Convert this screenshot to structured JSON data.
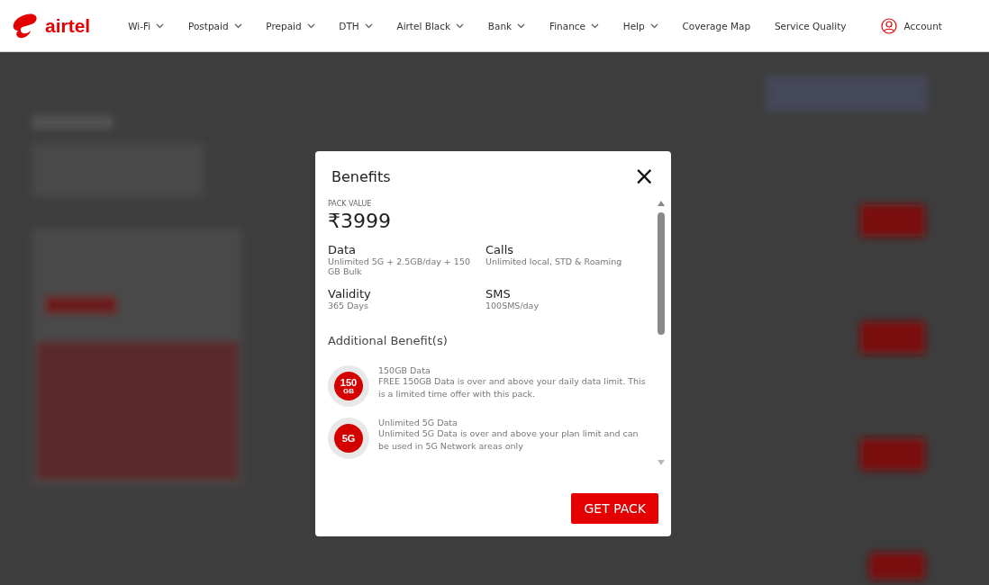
{
  "header": {
    "brand": "airtel",
    "nav": [
      {
        "label": "Wi-Fi",
        "dropdown": true
      },
      {
        "label": "Postpaid",
        "dropdown": true
      },
      {
        "label": "Prepaid",
        "dropdown": true
      },
      {
        "label": "DTH",
        "dropdown": true
      },
      {
        "label": "Airtel Black",
        "dropdown": true
      },
      {
        "label": "Bank",
        "dropdown": true
      },
      {
        "label": "Finance",
        "dropdown": true
      },
      {
        "label": "Help",
        "dropdown": true
      },
      {
        "label": "Coverage Map",
        "dropdown": false
      },
      {
        "label": "Service Quality",
        "dropdown": false
      }
    ],
    "account": "Account"
  },
  "modal": {
    "title": "Benefits",
    "close": "×",
    "pack_value_label": "PACK VALUE",
    "price": "₹3999",
    "details": [
      {
        "label": "Data",
        "value": "Unlimited 5G + 2.5GB/day + 150 GB Bulk"
      },
      {
        "label": "Calls",
        "value": "Unlimited local, STD & Roaming"
      },
      {
        "label": "Validity",
        "value": "365 Days"
      },
      {
        "label": "SMS",
        "value": "100SMS/day"
      }
    ],
    "additional_title": "Additional Benefit(s)",
    "benefits": [
      {
        "badge": "150",
        "badge_sub": "GB",
        "title": "150GB Data",
        "description": "FREE 150GB Data is over and above your daily data limit. This is a limited time offer with this pack."
      },
      {
        "badge": "5G",
        "title": "Unlimited 5G Data",
        "description": "Unlimited 5G Data is over and above your plan limit and can be used in 5G Network areas only"
      }
    ],
    "button": "GET PACK"
  }
}
